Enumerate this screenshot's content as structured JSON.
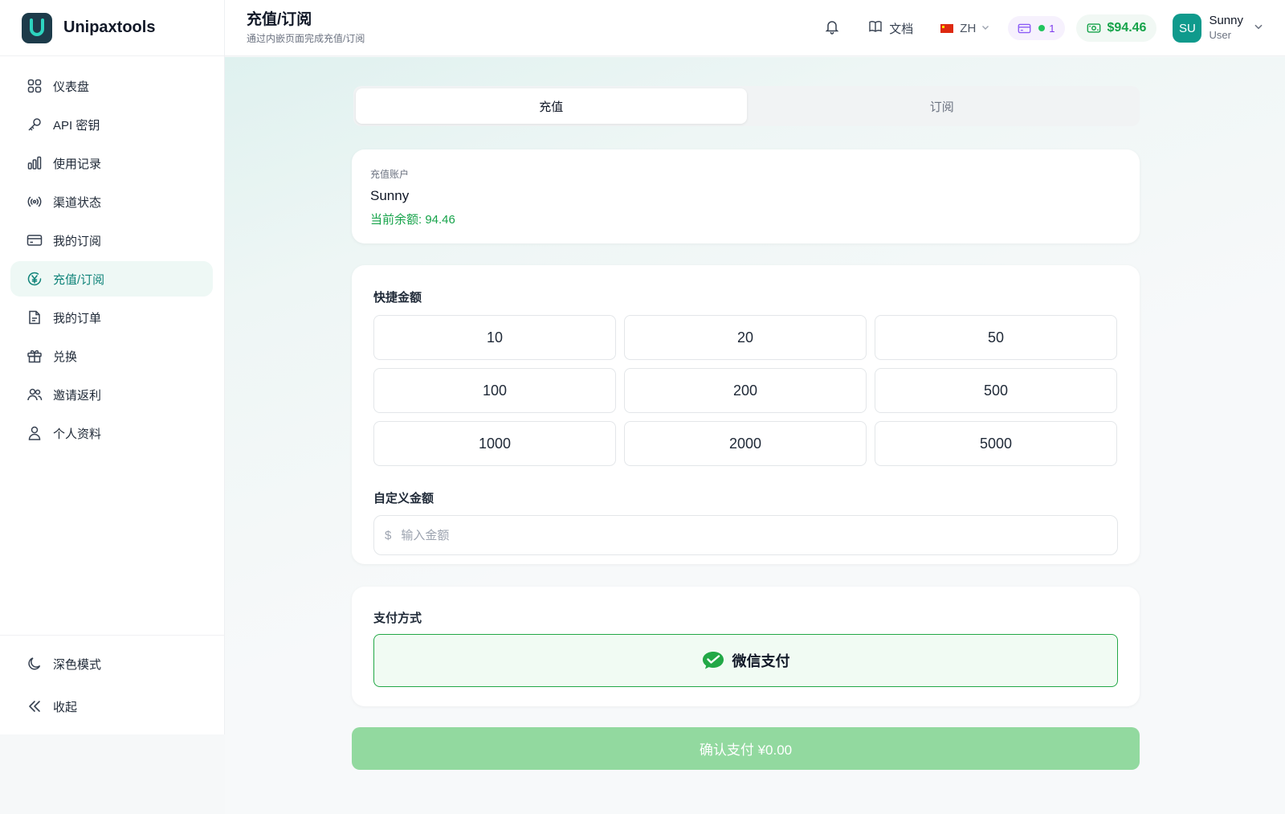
{
  "brand": {
    "name": "Unipaxtools",
    "logo_letter": "U"
  },
  "sidebar": {
    "items": [
      {
        "label": "仪表盘",
        "icon": "grid-icon"
      },
      {
        "label": "API 密钥",
        "icon": "key-icon"
      },
      {
        "label": "使用记录",
        "icon": "bar-chart-icon"
      },
      {
        "label": "渠道状态",
        "icon": "broadcast-icon"
      },
      {
        "label": "我的订阅",
        "icon": "credit-card-icon"
      },
      {
        "label": "充值/订阅",
        "icon": "yen-icon",
        "active": true
      },
      {
        "label": "我的订单",
        "icon": "document-icon"
      },
      {
        "label": "兑换",
        "icon": "gift-icon"
      },
      {
        "label": "邀请返利",
        "icon": "users-icon"
      },
      {
        "label": "个人资料",
        "icon": "user-icon"
      }
    ],
    "bottom": [
      {
        "label": "深色模式",
        "icon": "moon-icon"
      },
      {
        "label": "收起",
        "icon": "double-chevron-left-icon"
      }
    ]
  },
  "header": {
    "title": "充值/订阅",
    "subtitle": "通过内嵌页面完成充值/订阅",
    "docs_label": "文档",
    "lang": "ZH",
    "subscription_count": "1",
    "balance": "$94.46",
    "user": {
      "initials": "SU",
      "name": "Sunny",
      "role": "User"
    }
  },
  "tabs": [
    {
      "label": "充值",
      "active": true
    },
    {
      "label": "订阅",
      "active": false
    }
  ],
  "account": {
    "label": "充值账户",
    "name": "Sunny",
    "balance_text": "当前余额: 94.46"
  },
  "amounts": {
    "label": "快捷金额",
    "options": [
      "10",
      "20",
      "50",
      "100",
      "200",
      "500",
      "1000",
      "2000",
      "5000"
    ],
    "custom_label": "自定义金额",
    "currency_symbol": "$",
    "custom_placeholder": "输入金额",
    "custom_value": ""
  },
  "payment": {
    "label": "支付方式",
    "method": "微信支付",
    "icon": "wechat-pay-icon"
  },
  "confirm_label": "确认支付 ¥0.00",
  "colors": {
    "accent": "#11847a",
    "success": "#16a34a",
    "wechat_green": "#22a846",
    "confirm_bg": "#92d99f"
  }
}
